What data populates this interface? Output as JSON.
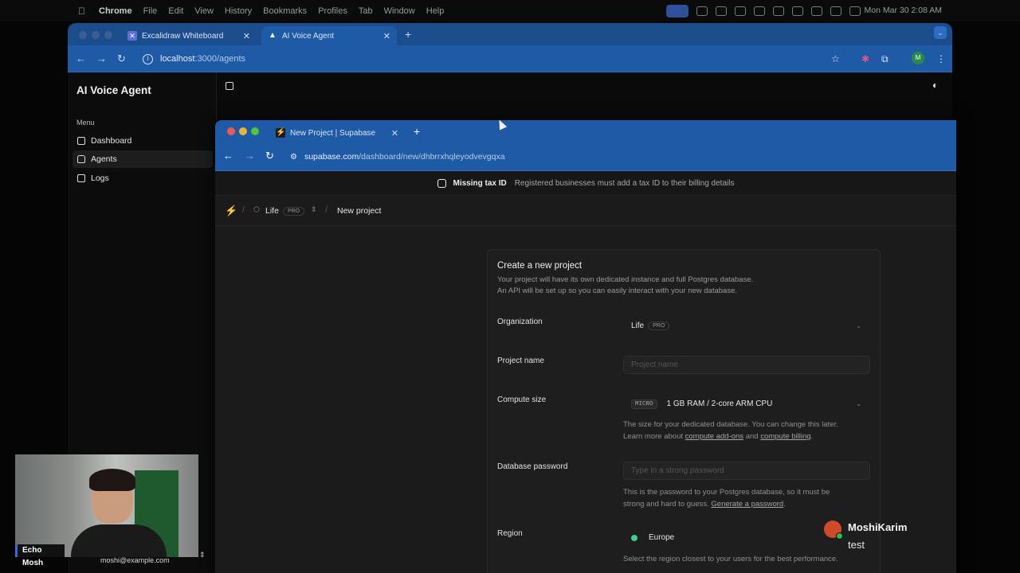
{
  "menubar": {
    "app": "Chrome",
    "items": [
      "File",
      "Edit",
      "View",
      "History",
      "Bookmarks",
      "Profiles",
      "Tab",
      "Window",
      "Help"
    ],
    "clock": "Mon Mar 30  2:08 AM"
  },
  "outer_browser": {
    "tabs": [
      {
        "label": "Excalidraw Whiteboard",
        "active": false
      },
      {
        "label": "AI Voice Agent",
        "active": true
      }
    ],
    "url_host": "localhost",
    "url_path": ":3000/agents",
    "profile_initial": "M"
  },
  "app": {
    "title": "AI Voice Agent",
    "menu_label": "Menu",
    "nav": [
      {
        "label": "Dashboard",
        "icon": "grid-icon",
        "active": false
      },
      {
        "label": "Agents",
        "icon": "bot-icon",
        "active": true
      },
      {
        "label": "Logs",
        "icon": "logs-icon",
        "active": false
      }
    ]
  },
  "inner_browser": {
    "tab_label": "New Project | Supabase",
    "url_host": "supabase.com",
    "url_path": "/dashboard/new/dhbrrxhqleyodvevgqxa"
  },
  "banner": {
    "title": "Missing tax ID",
    "desc": "Registered businesses must add a tax ID to their billing details"
  },
  "breadcrumb": {
    "org": "Life",
    "org_badge": "PRO",
    "page": "New project"
  },
  "form": {
    "heading": "Create a new project",
    "desc1": "Your project will have its own dedicated instance and full Postgres database.",
    "desc2": "An API will be set up so you can easily interact with your new database.",
    "organization_label": "Organization",
    "organization_value": "Life",
    "organization_badge": "PRO",
    "project_name_label": "Project name",
    "project_name_placeholder": "Project name",
    "compute_label": "Compute size",
    "compute_tier": "MICRO",
    "compute_value": "1 GB RAM / 2-core ARM CPU",
    "compute_help1": "The size for your dedicated database. You can change this later.",
    "compute_help2_pre": "Learn more about ",
    "compute_help2_link1": "compute add-ons",
    "compute_help2_mid": " and ",
    "compute_help2_link2": "compute billing",
    "compute_help2_post": ".",
    "password_label": "Database password",
    "password_placeholder": "Type in a strong password",
    "password_help1": "This is the password to your Postgres database, so it must be",
    "password_help2_pre": "strong and hard to guess. ",
    "password_help2_link": "Generate a password",
    "password_help2_post": ".",
    "region_label": "Region",
    "region_value": "Europe",
    "region_help": "Select the region closest to your users for the best performance."
  },
  "webcam": {
    "name": "Echo Mosh",
    "email": "moshi@example.com"
  },
  "chat": {
    "name": "MoshiKarim",
    "message": "test"
  },
  "colors": {
    "chrome_blue": "#1e5aa6",
    "supabase_green": "#3ecf8e"
  }
}
